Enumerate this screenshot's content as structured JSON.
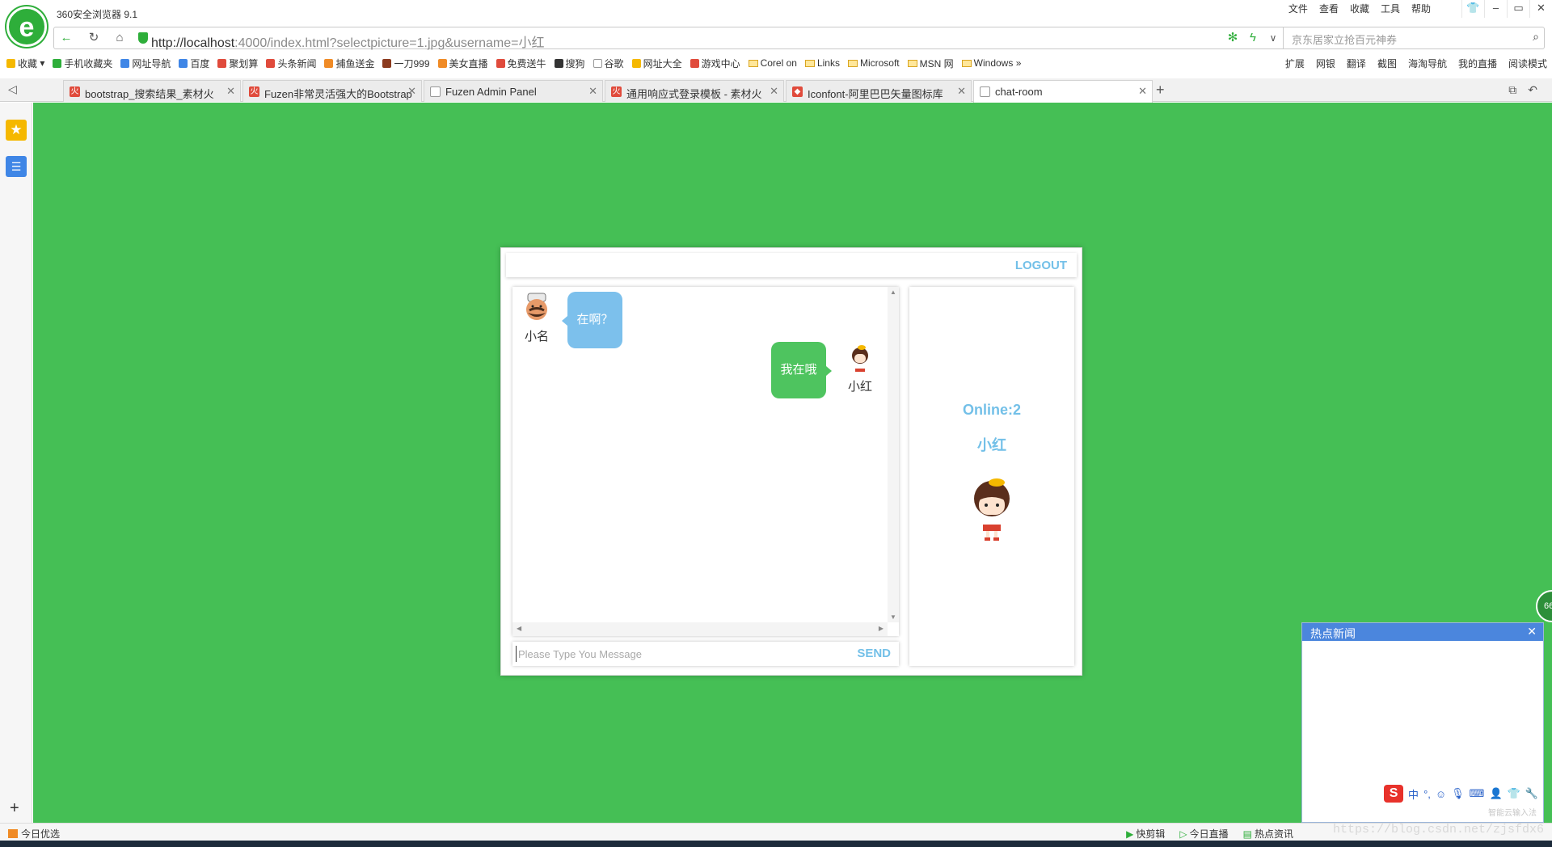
{
  "browser": {
    "title": "360安全浏览器 9.1",
    "menu": [
      "文件",
      "查看",
      "收藏",
      "工具",
      "帮助"
    ],
    "url_host": "http://localhost",
    "url_rest": ":4000/index.html?selectpicture=1.jpg&username=小红",
    "search_placeholder": "京东居家立抢百元神券",
    "bookmarks": [
      "收藏",
      "手机收藏夹",
      "网址导航",
      "百度",
      "聚划算",
      "头条新闻",
      "捕鱼送金",
      "一刀999",
      "美女直播",
      "免费送牛",
      "搜狗",
      "谷歌",
      "网址大全",
      "游戏中心",
      "Corel on",
      "Links",
      "Microsoft",
      "MSN 网",
      "Windows"
    ],
    "bookmarks_right": [
      "扩展",
      "网银",
      "翻译",
      "截图",
      "海淘导航",
      "我的直播",
      "阅读模式"
    ],
    "tabs": [
      {
        "label": "bootstrap_搜索结果_素材火"
      },
      {
        "label": "Fuzen非常灵活强大的Bootstrap"
      },
      {
        "label": "Fuzen Admin Panel"
      },
      {
        "label": "通用响应式登录模板 - 素材火"
      },
      {
        "label": "Iconfont-阿里巴巴矢量图标库"
      },
      {
        "label": "chat-room"
      }
    ]
  },
  "chat": {
    "logout_label": "LOGOUT",
    "messages": [
      {
        "user": "小名",
        "text": "在啊？",
        "side": "left"
      },
      {
        "user": "小红",
        "text": "我在哦",
        "side": "right"
      }
    ],
    "input_placeholder": "Please Type You Message",
    "send_label": "SEND",
    "online_label": "Online:2",
    "current_user": "小红",
    "side_badge": "66"
  },
  "news": {
    "title": "热点新闻",
    "ime_label": "中",
    "cloud_text": "智能云输入法"
  },
  "status": {
    "left": "今日优选",
    "right": [
      "快剪辑",
      "今日直播",
      "热点资讯"
    ],
    "watermark": "https://blog.csdn.net/zjsfdx6"
  },
  "colors": {
    "page_bg": "#45bf55",
    "accent": "#73c0e8",
    "bubble_left": "#7cc0ec",
    "bubble_right": "#4ec45f"
  }
}
